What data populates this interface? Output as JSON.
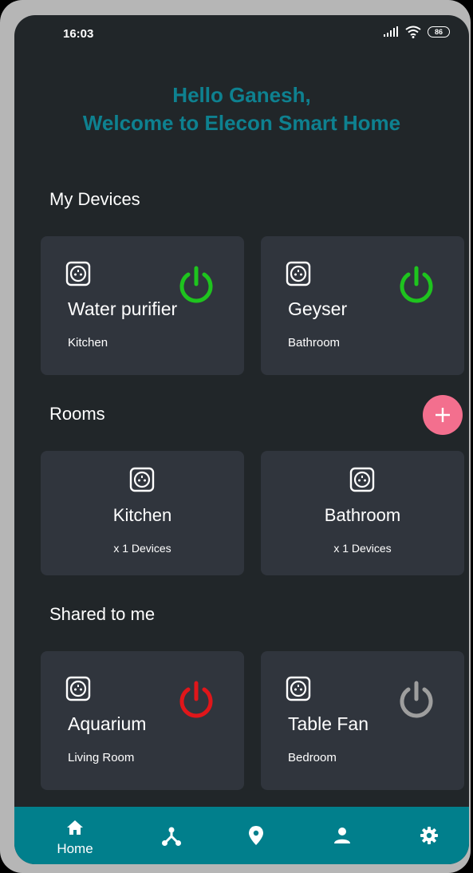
{
  "status": {
    "time": "16:03",
    "battery": "86"
  },
  "greeting": {
    "line1": "Hello Ganesh,",
    "line2": "Welcome to Elecon Smart Home"
  },
  "sections": {
    "my_devices": "My Devices",
    "rooms": "Rooms",
    "shared": "Shared to me"
  },
  "devices": [
    {
      "name": "Water purifier",
      "room": "Kitchen",
      "power": "on"
    },
    {
      "name": "Geyser",
      "room": "Bathroom",
      "power": "on"
    }
  ],
  "rooms": [
    {
      "name": "Kitchen",
      "count": "x 1 Devices"
    },
    {
      "name": "Bathroom",
      "count": "x 1 Devices"
    }
  ],
  "shared": [
    {
      "name": "Aquarium",
      "room": "Living Room",
      "power": "off-red"
    },
    {
      "name": "Table Fan",
      "room": "Bedroom",
      "power": "inactive"
    }
  ],
  "nav": {
    "home_label": "Home"
  },
  "icons": [
    "socket-icon",
    "power-icon",
    "plus-icon",
    "home-icon",
    "network-icon",
    "location-icon",
    "person-icon",
    "gear-icon",
    "signal-icon",
    "wifi-icon"
  ],
  "colors": {
    "accent": "#0e8190",
    "power_on": "#1ec41e",
    "power_off": "#e0161a",
    "power_idle": "#9e9e9e",
    "fab": "#f36f8e",
    "nav": "#017f8c"
  }
}
